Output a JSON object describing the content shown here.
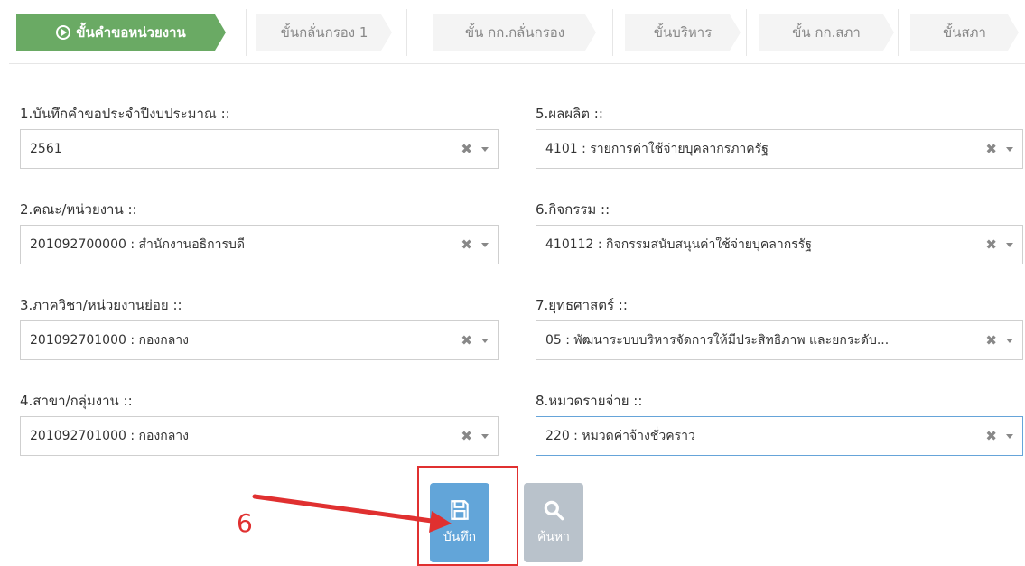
{
  "wizard": {
    "steps": [
      {
        "label": "ขั้นคำขอหน่วยงาน",
        "active": true
      },
      {
        "label": "ขั้นกลั่นกรอง 1",
        "active": false
      },
      {
        "label": "ขั้น กก.กลั่นกรอง",
        "active": false
      },
      {
        "label": "ขั้นบริหาร",
        "active": false
      },
      {
        "label": "ขั้น กก.สภา",
        "active": false
      },
      {
        "label": "ขั้นสภา",
        "active": false
      }
    ]
  },
  "form": {
    "fields": [
      {
        "label": "1.บันทึกคำขอประจำปีงบประมาณ ::",
        "value": "2561"
      },
      {
        "label": "2.คณะ/หน่วยงาน ::",
        "value": "201092700000 : สำนักงานอธิการบดี"
      },
      {
        "label": "3.ภาควิชา/หน่วยงานย่อย ::",
        "value": "201092701000 : กองกลาง"
      },
      {
        "label": "4.สาขา/กลุ่มงาน ::",
        "value": "201092701000 : กองกลาง"
      },
      {
        "label": "5.ผลผลิต ::",
        "value": "4101 : รายการค่าใช้จ่ายบุคลากรภาครัฐ"
      },
      {
        "label": "6.กิจกรรม ::",
        "value": "410112 : กิจกรรมสนับสนุนค่าใช้จ่ายบุคลากรรัฐ"
      },
      {
        "label": "7.ยุทธศาสตร์ ::",
        "value": "05 : พัฒนาระบบบริหารจัดการให้มีประสิทธิภาพ และยกระดับ..."
      },
      {
        "label": "8.หมวดรายจ่าย ::",
        "value": "220 : หมวดค่าจ้างชั่วคราว"
      }
    ],
    "clear_glyph": "✖"
  },
  "buttons": {
    "save_label": "บันทึก",
    "search_label": "ค้นหา"
  },
  "annotation": {
    "number": "6"
  },
  "colors": {
    "active_step": "#6aaa64",
    "save_button": "#62a5d9",
    "search_button": "#b9c2cb",
    "annotation": "#e03030"
  }
}
